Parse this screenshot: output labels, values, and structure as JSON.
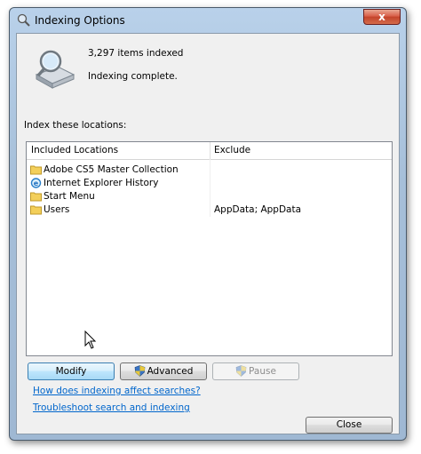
{
  "window": {
    "title": "Indexing Options",
    "close_label": "x"
  },
  "status": {
    "items_indexed": "3,297 items indexed",
    "message": "Indexing complete."
  },
  "locations_label": "Index these locations:",
  "table": {
    "headers": {
      "included": "Included Locations",
      "exclude": "Exclude"
    },
    "rows": [
      {
        "icon": "folder-icon",
        "name": "Adobe CS5 Master Collection",
        "exclude": ""
      },
      {
        "icon": "internet-explorer-icon",
        "name": "Internet Explorer History",
        "exclude": ""
      },
      {
        "icon": "folder-icon",
        "name": "Start Menu",
        "exclude": ""
      },
      {
        "icon": "folder-icon",
        "name": "Users",
        "exclude": "AppData; AppData"
      }
    ]
  },
  "buttons": {
    "modify": "Modify",
    "advanced": "Advanced",
    "pause": "Pause",
    "close": "Close"
  },
  "links": {
    "how_indexing": "How does indexing affect searches?",
    "troubleshoot": "Troubleshoot search and indexing"
  },
  "colors": {
    "link": "#0066cc",
    "title_bar": "#b9d1ea",
    "dialog_bg": "#f0f0f0"
  }
}
